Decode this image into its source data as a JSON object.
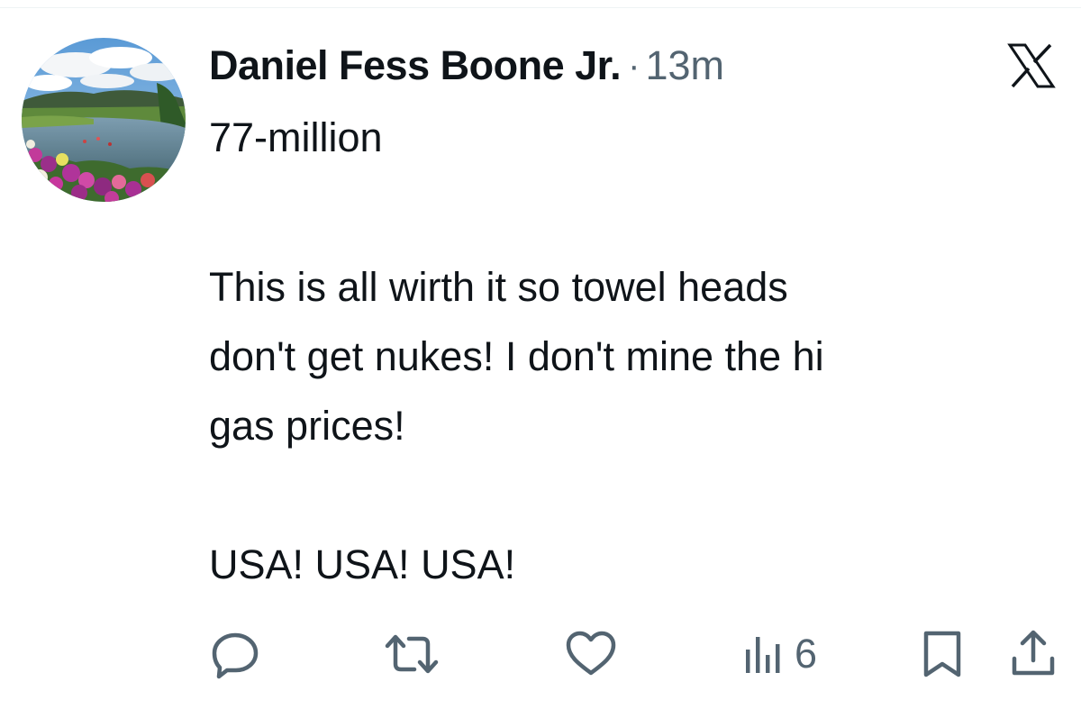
{
  "tweet": {
    "author": {
      "display_name": "Daniel Fess Boone Jr.",
      "handle_line": "77-million",
      "avatar_icon": "landscape-river-flowers-avatar"
    },
    "separator": "·",
    "timestamp": "13m",
    "platform_icon": "x-logo-icon",
    "body_lines": [
      "This is all wirth it so towel heads",
      "don't get nukes! I don't mine the hi",
      "gas prices!",
      "",
      "USA! USA! USA!"
    ],
    "actions": {
      "reply_icon": "reply-icon",
      "retweet_icon": "retweet-icon",
      "like_icon": "heart-icon",
      "views_icon": "analytics-bars-icon",
      "views_count": "6",
      "bookmark_icon": "bookmark-icon",
      "share_icon": "share-icon"
    }
  },
  "colors": {
    "text_primary": "#0f1419",
    "text_secondary": "#536471",
    "divider": "#eff3f4"
  }
}
